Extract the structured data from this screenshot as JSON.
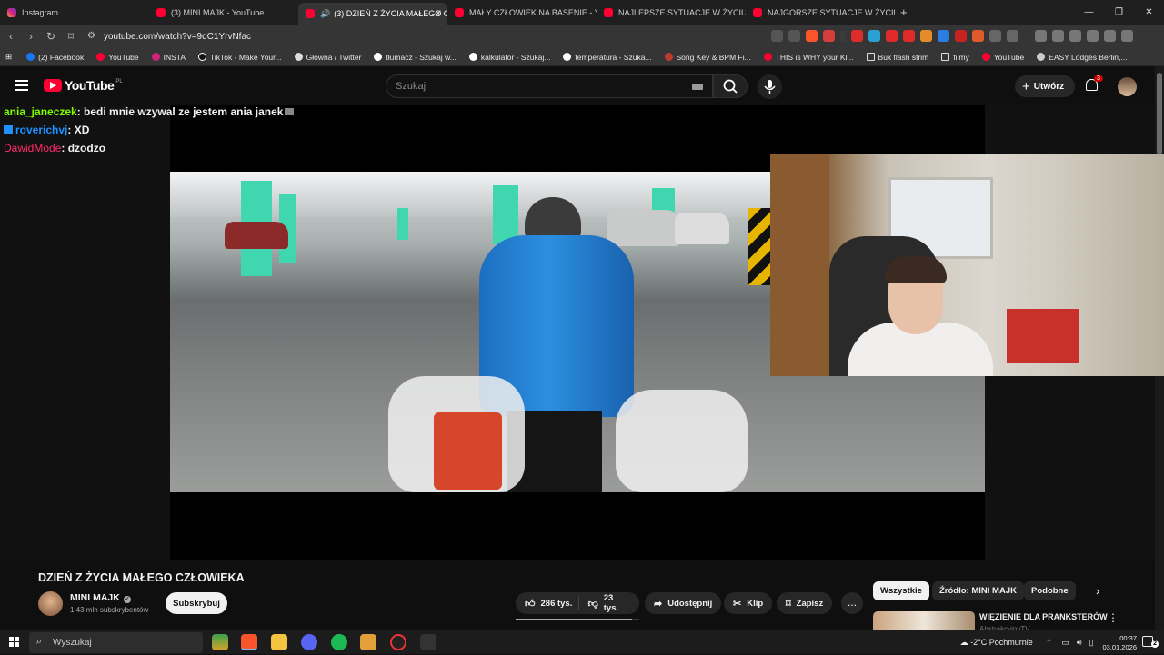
{
  "browser": {
    "tabs": [
      {
        "label": "Instagram",
        "icon": "instagram-icon"
      },
      {
        "label": "(3) MINI MAJK - YouTube",
        "icon": "youtube-icon"
      },
      {
        "label": "(3) DZIEŃ Z ŻYCIA MAŁEGO C",
        "icon": "youtube-icon",
        "active": true
      },
      {
        "label": "MAŁY CZŁOWIEK NA BASENIE - YouT",
        "icon": "youtube-icon"
      },
      {
        "label": "NAJLEPSZE SYTUACJE W ŻYCIU MAŁ",
        "icon": "youtube-icon"
      },
      {
        "label": "NAJGORSZE SYTUACJE W ŻYCIU MA",
        "icon": "youtube-icon"
      }
    ],
    "new_tab": "+",
    "url": "youtube.com/watch?v=9dC1YrvNfac",
    "bookmarks": [
      {
        "label": "(2) Facebook",
        "color": "#1877f2"
      },
      {
        "label": "YouTube",
        "color": "#ff0033"
      },
      {
        "label": "INSTA",
        "color": "#d4237a"
      },
      {
        "label": "TikTok - Make Your...",
        "color": "#111111"
      },
      {
        "label": "Główna / Twitter",
        "color": "#dddddd"
      },
      {
        "label": "tłumacz - Szukaj w...",
        "color": "#ffffff"
      },
      {
        "label": "kalkulator - Szukaj...",
        "color": "#ffffff"
      },
      {
        "label": "temperatura - Szuka...",
        "color": "#ffffff"
      },
      {
        "label": "Song Key & BPM Fi...",
        "color": "#c0392b"
      },
      {
        "label": "THIS is WHY your Kl...",
        "color": "#ff0033"
      },
      {
        "label": "Buk flash strim",
        "color": "#888888"
      },
      {
        "label": "filmy",
        "color": "#888888"
      },
      {
        "label": "YouTube",
        "color": "#ff0033"
      },
      {
        "label": "EASY Lodges Berlin,...",
        "color": "#cccccc"
      }
    ]
  },
  "youtube": {
    "logo": "YouTube",
    "region": "PL",
    "search_placeholder": "Szukaj",
    "create_label": "Utwórz",
    "notifications_count": "3"
  },
  "chat": [
    {
      "user": "ania_janeczek",
      "color": "#7fff00",
      "message": ": bedi mnie wzywal ze jestem ania janek"
    },
    {
      "user": "roverichvj",
      "color": "#1e90ff",
      "message": ": XD"
    },
    {
      "user": "DawidMode",
      "color": "#ff2a6d",
      "message": ": dzodzo"
    }
  ],
  "video": {
    "title": "DZIEŃ Z ŻYCIA MAŁEGO CZŁOWIEKA",
    "channel": "MINI MAJK",
    "subscribers": "1,43 mln subskrybentów",
    "subscribe_label": "Subskrybuj",
    "likes": "286 tys.",
    "dislikes": "23 tys.",
    "share_label": "Udostępnij",
    "clip_label": "Klip",
    "save_label": "Zapisz",
    "more": "..."
  },
  "recommend": {
    "chips": [
      "Wszystkie",
      "Źródło: MINI MAJK",
      "Podobne"
    ],
    "first_title": "WIĘZIENIE DLA PRANKSTERÓW",
    "first_channel": "AbstrakcyjnyTV"
  },
  "taskbar": {
    "search_placeholder": "Wyszukaj",
    "weather": "-2°C  Pochmurnie",
    "time": "00:37",
    "date": "03.01.2026",
    "notifications": "2"
  }
}
